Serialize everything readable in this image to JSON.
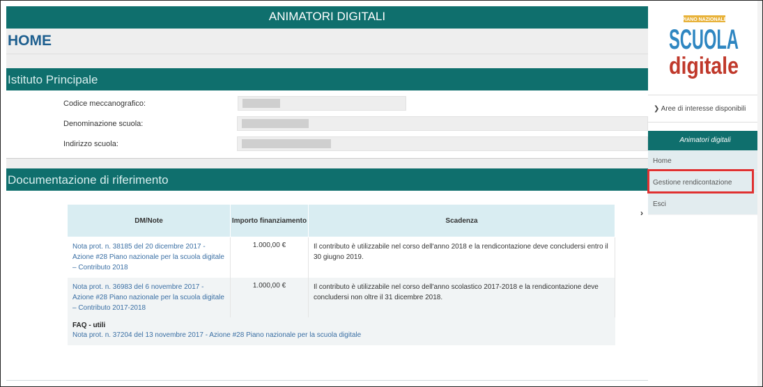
{
  "header": {
    "title": "ANIMATORI DIGITALI"
  },
  "page": {
    "title": "HOME"
  },
  "istituto": {
    "heading": "Istituto Principale",
    "fields": [
      {
        "label": "Codice meccanografico:"
      },
      {
        "label": "Denominazione scuola:"
      },
      {
        "label": "Indirizzo scuola:"
      }
    ]
  },
  "documentazione": {
    "heading": "Documentazione di riferimento",
    "columns": [
      "DM/Note",
      "Importo finanziamento",
      "Scadenza"
    ],
    "rows": [
      {
        "note": "Nota prot. n. 38185 del 20 dicembre 2017 - Azione #28 Piano nazionale per la scuola digitale – Contributo 2018",
        "importo": "1.000,00 €",
        "scadenza": "Il contributo è utilizzabile nel corso dell'anno 2018 e la rendicontazione deve concludersi entro il 30 giugno 2019."
      },
      {
        "note": "Nota prot. n. 36983 del 6 novembre 2017 - Azione #28 Piano nazionale per la scuola digitale – Contributo 2017-2018",
        "importo": "1.000,00 €",
        "scadenza": "Il contributo è utilizzabile nel corso dell'anno scolastico 2017-2018 e la rendicontazione deve concludersi non oltre il 31 dicembre 2018."
      }
    ],
    "faq": {
      "title": "FAQ - utili",
      "link": "Nota prot. n. 37204 del 13 novembre 2017 - Azione #28 Piano nazionale per la scuola digitale"
    }
  },
  "sidebar": {
    "logo": {
      "top": "PIANO NAZIONALE",
      "word1": "SCUOLA",
      "word2": "digitale"
    },
    "areas_label": "Aree di interesse disponibili",
    "menu_heading": "Animatori digitali",
    "menu_items": [
      "Home",
      "Gestione rendicontazione",
      "Esci"
    ]
  },
  "colors": {
    "teal": "#0f6f6d",
    "title_blue": "#1e5f8f",
    "link": "#3a6fa4",
    "highlight": "#e03131"
  }
}
